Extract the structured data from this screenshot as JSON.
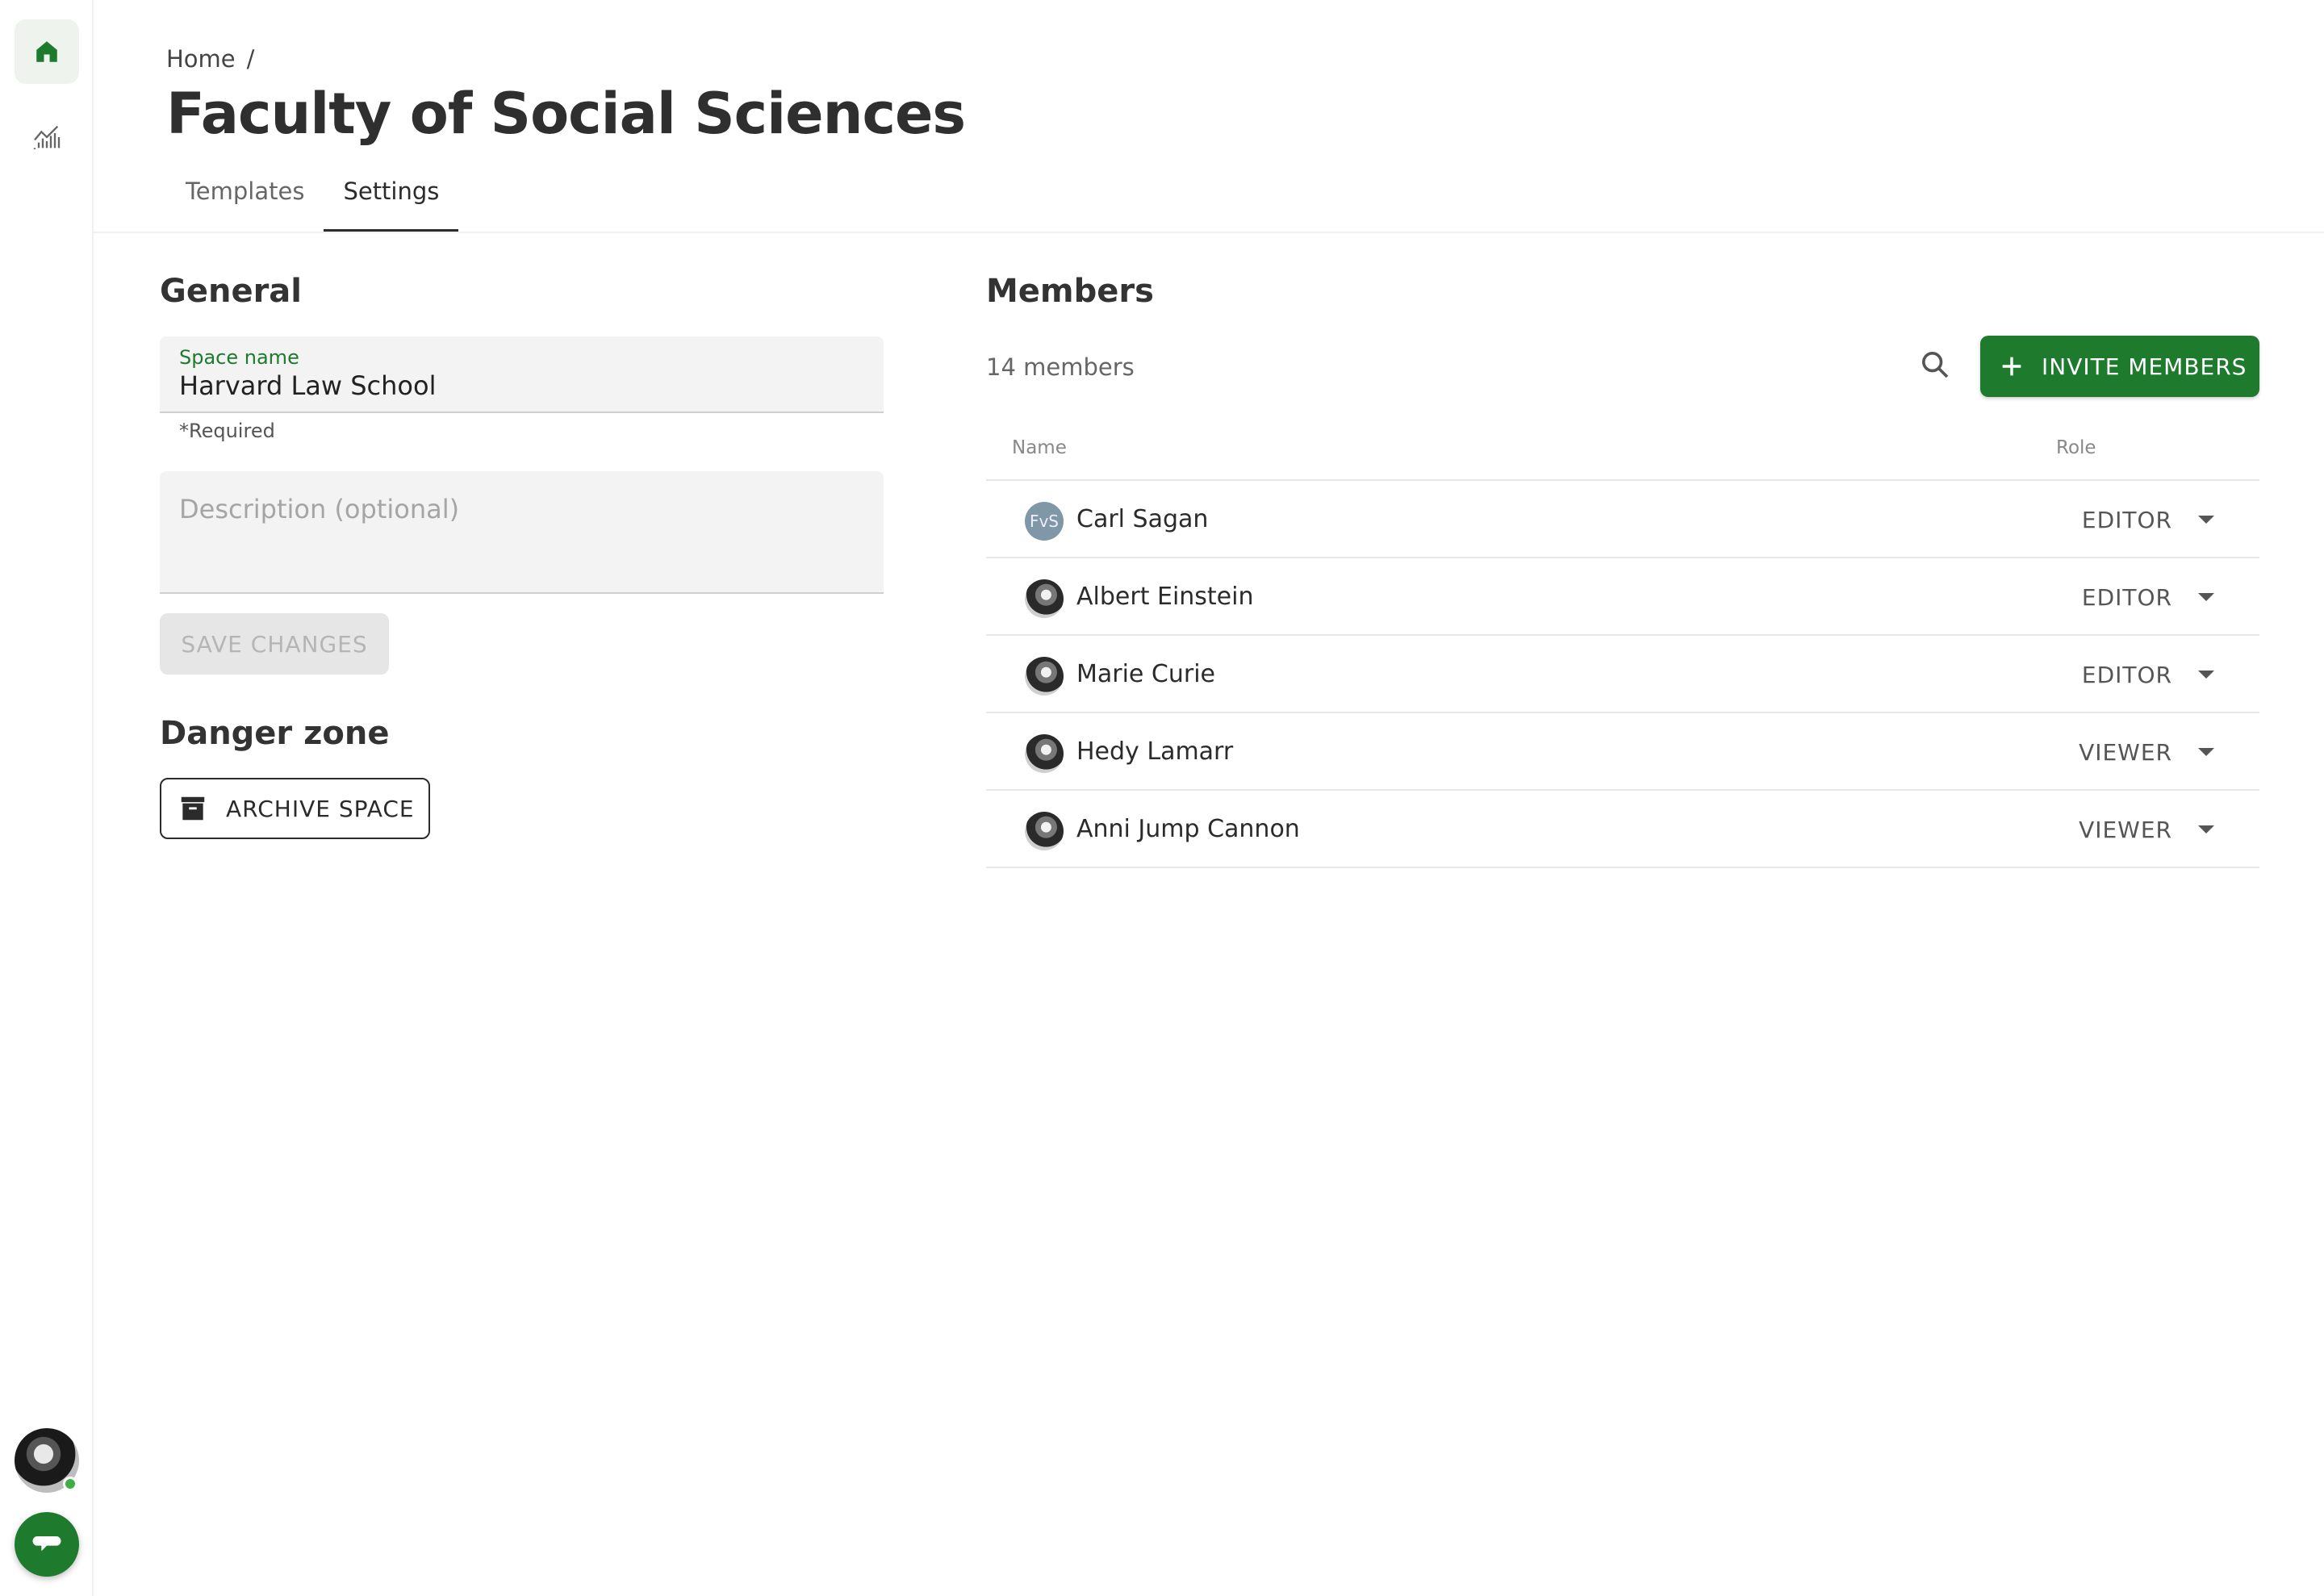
{
  "rail": {
    "items": [
      {
        "icon": "home-icon",
        "active": true
      },
      {
        "icon": "analytics-icon",
        "active": false
      }
    ],
    "accent": "#1e7a2c"
  },
  "header": {
    "breadcrumb": "Home",
    "breadcrumb_sep": "/",
    "title": "Faculty of Social Sciences",
    "tabs": [
      {
        "label": "Templates",
        "active": false
      },
      {
        "label": "Settings",
        "active": true
      }
    ]
  },
  "general": {
    "heading": "General",
    "space_name_label": "Space name",
    "space_name_value": "Harvard Law School",
    "required_hint": "*Required",
    "description_placeholder": "Description (optional)",
    "save_label": "SAVE CHANGES"
  },
  "danger": {
    "heading": "Danger zone",
    "archive_label": "ARCHIVE SPACE"
  },
  "members": {
    "heading": "Members",
    "count_text": "14 members",
    "invite_label": "INVITE MEMBERS",
    "columns": {
      "name": "Name",
      "role": "Role"
    },
    "rows": [
      {
        "name": "Carl Sagan",
        "role": "EDITOR",
        "avatar_initials": "FvS"
      },
      {
        "name": "Albert Einstein",
        "role": "EDITOR",
        "avatar_initials": ""
      },
      {
        "name": "Marie Curie",
        "role": "EDITOR",
        "avatar_initials": ""
      },
      {
        "name": "Hedy Lamarr",
        "role": "VIEWER",
        "avatar_initials": ""
      },
      {
        "name": "Anni Jump Cannon",
        "role": "VIEWER",
        "avatar_initials": ""
      }
    ]
  }
}
